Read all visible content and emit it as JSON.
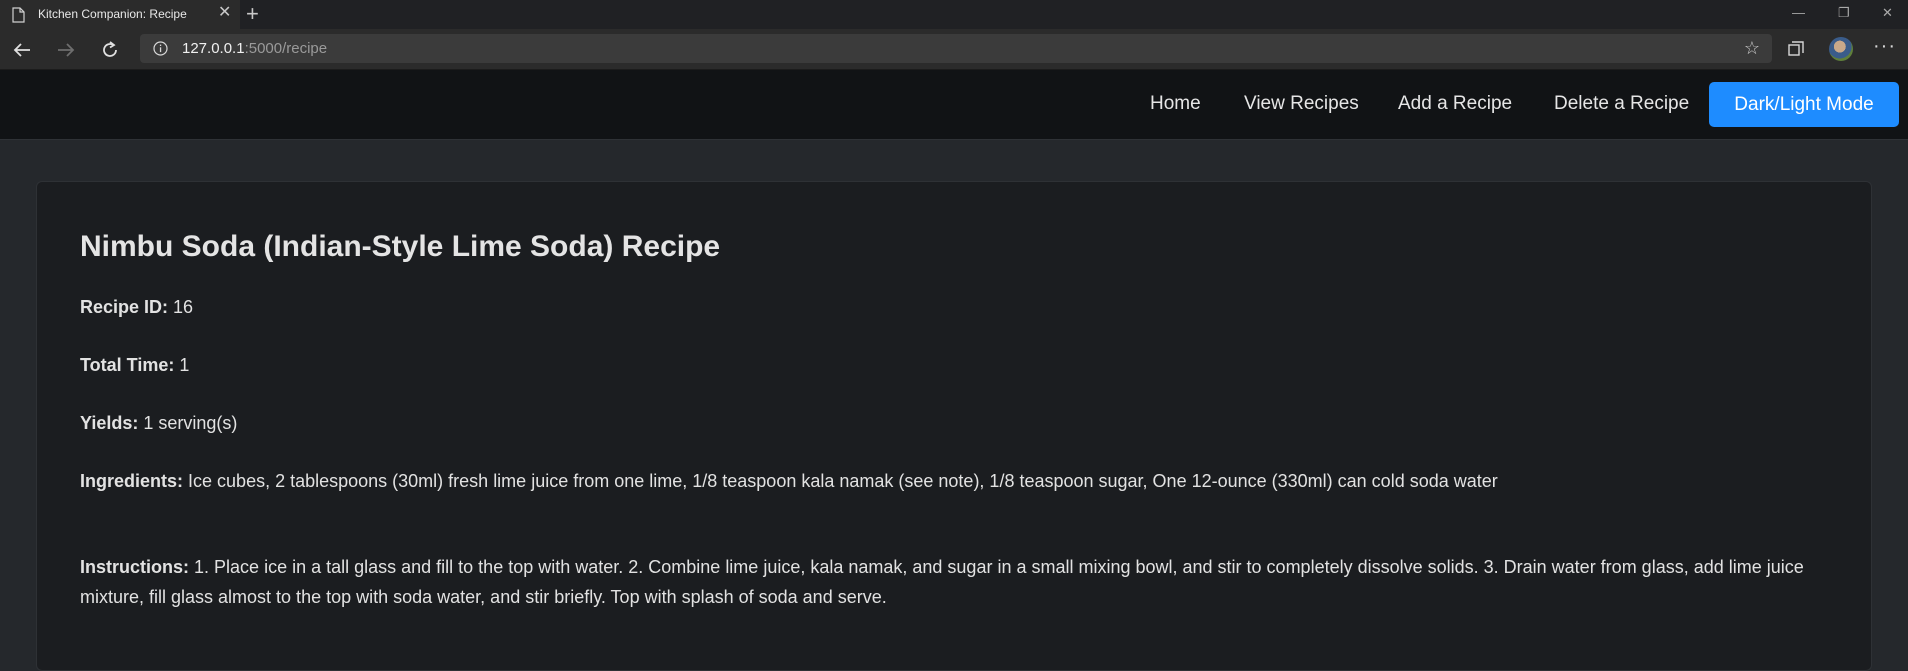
{
  "browser": {
    "tab_title": "Kitchen Companion: Recipe",
    "url_host": "127.0.0.1",
    "url_rest": ":5000/recipe"
  },
  "navbar": {
    "links": [
      "Home",
      "View Recipes",
      "Add a Recipe",
      "Delete a Recipe"
    ],
    "mode_button": "Dark/Light Mode",
    "mode_button_color": "#1e8cff"
  },
  "recipe": {
    "title": "Nimbu Soda (Indian-Style Lime Soda) Recipe",
    "id_label": "Recipe ID:",
    "id_value": "16",
    "time_label": "Total Time:",
    "time_value": "1",
    "yields_label": "Yields:",
    "yields_value": "1 serving(s)",
    "ingredients_label": "Ingredients:",
    "ingredients_value": "Ice cubes, 2 tablespoons (30ml) fresh lime juice from one lime, 1/8 teaspoon kala namak (see note), 1/8 teaspoon sugar, One 12-ounce (330ml) can cold soda water",
    "instructions_label": "Instructions:",
    "instructions_value": "1. Place ice in a tall glass and fill to the top with water. 2. Combine lime juice, kala namak, and sugar in a small mixing bowl, and stir to completely dissolve solids. 3. Drain water from glass, add lime juice mixture, fill glass almost to the top with soda water, and stir briefly. Top with splash of soda and serve."
  }
}
